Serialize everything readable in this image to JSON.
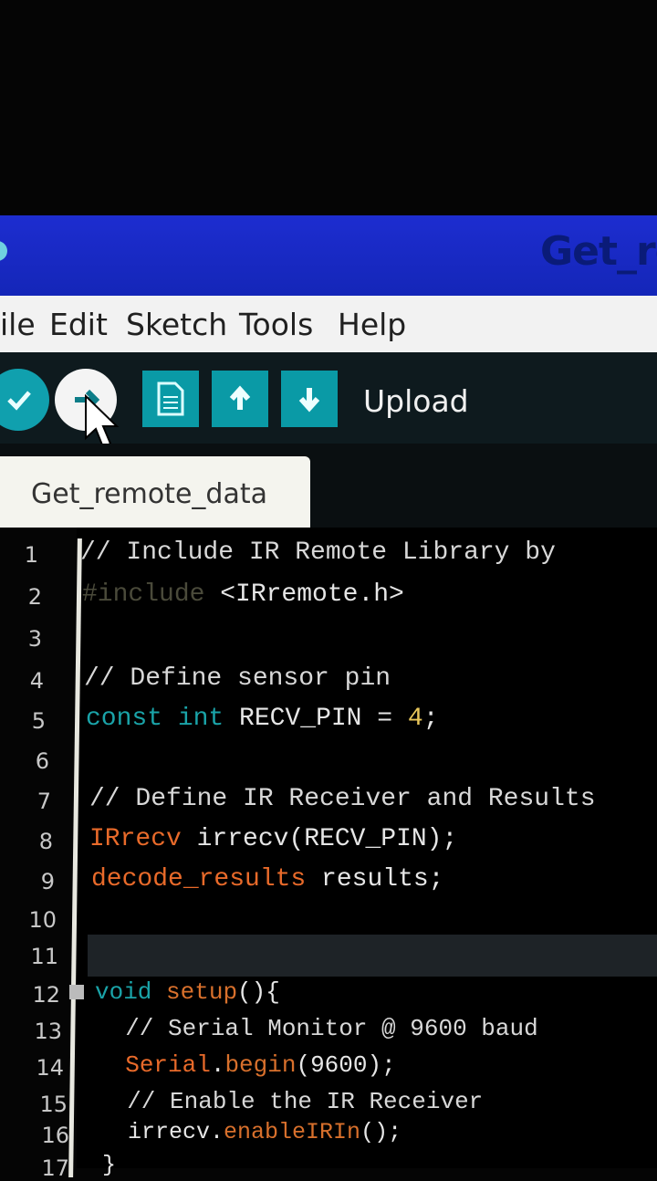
{
  "window": {
    "title": "Get_re"
  },
  "menu": {
    "items": [
      {
        "label": "ile"
      },
      {
        "label": "Edit"
      },
      {
        "label": "Sketch"
      },
      {
        "label": "Tools"
      },
      {
        "label": "Help"
      }
    ]
  },
  "toolbar": {
    "verify_icon": "check-icon",
    "upload_icon": "arrow-right-icon",
    "new_icon": "document-icon",
    "open_icon": "arrow-up-icon",
    "save_icon": "arrow-down-icon",
    "status_label": "Upload"
  },
  "tab": {
    "label": "Get_remote_data"
  },
  "editor": {
    "line_numbers": [
      "1",
      "2",
      "3",
      "4",
      "5",
      "6",
      "7",
      "8",
      "9",
      "10",
      "11",
      "12",
      "13",
      "14",
      "15",
      "16",
      "17"
    ],
    "lines": [
      {
        "parts": [
          {
            "t": "// Include IR Remote Library by ",
            "c": "cmt"
          }
        ]
      },
      {
        "parts": [
          {
            "t": "#include",
            "c": "pp"
          },
          {
            "t": " <IRremote.h>",
            "c": ""
          }
        ]
      },
      {
        "parts": []
      },
      {
        "parts": [
          {
            "t": "// Define sensor pin",
            "c": "cmt"
          }
        ]
      },
      {
        "parts": [
          {
            "t": "const",
            "c": "kw"
          },
          {
            "t": " ",
            "c": ""
          },
          {
            "t": "int",
            "c": "kw"
          },
          {
            "t": " RECV_PIN = ",
            "c": ""
          },
          {
            "t": "4",
            "c": "num"
          },
          {
            "t": ";",
            "c": ""
          }
        ]
      },
      {
        "parts": []
      },
      {
        "parts": [
          {
            "t": "// Define IR Receiver and Results",
            "c": "cmt"
          }
        ]
      },
      {
        "parts": [
          {
            "t": "IRrecv",
            "c": "type"
          },
          {
            "t": " irrecv(RECV_PIN);",
            "c": ""
          }
        ]
      },
      {
        "parts": [
          {
            "t": "decode_results",
            "c": "type"
          },
          {
            "t": " results;",
            "c": ""
          }
        ]
      },
      {
        "parts": []
      },
      {
        "parts": []
      },
      {
        "parts": [
          {
            "t": "void",
            "c": "kw"
          },
          {
            "t": " ",
            "c": ""
          },
          {
            "t": "setup",
            "c": "fn"
          },
          {
            "t": "(){",
            "c": ""
          }
        ]
      },
      {
        "parts": [
          {
            "t": "  // Serial Monitor @ 9600 baud",
            "c": "cmt"
          }
        ]
      },
      {
        "parts": [
          {
            "t": "  ",
            "c": ""
          },
          {
            "t": "Serial",
            "c": "type"
          },
          {
            "t": ".",
            "c": ""
          },
          {
            "t": "begin",
            "c": "fn"
          },
          {
            "t": "(9600);",
            "c": ""
          }
        ]
      },
      {
        "parts": [
          {
            "t": "  // Enable the IR Receiver",
            "c": "cmt"
          }
        ]
      },
      {
        "parts": [
          {
            "t": "  irrecv.",
            "c": ""
          },
          {
            "t": "enableIRIn",
            "c": "fn"
          },
          {
            "t": "();",
            "c": ""
          }
        ]
      },
      {
        "parts": [
          {
            "t": "}",
            "c": ""
          }
        ]
      }
    ]
  }
}
